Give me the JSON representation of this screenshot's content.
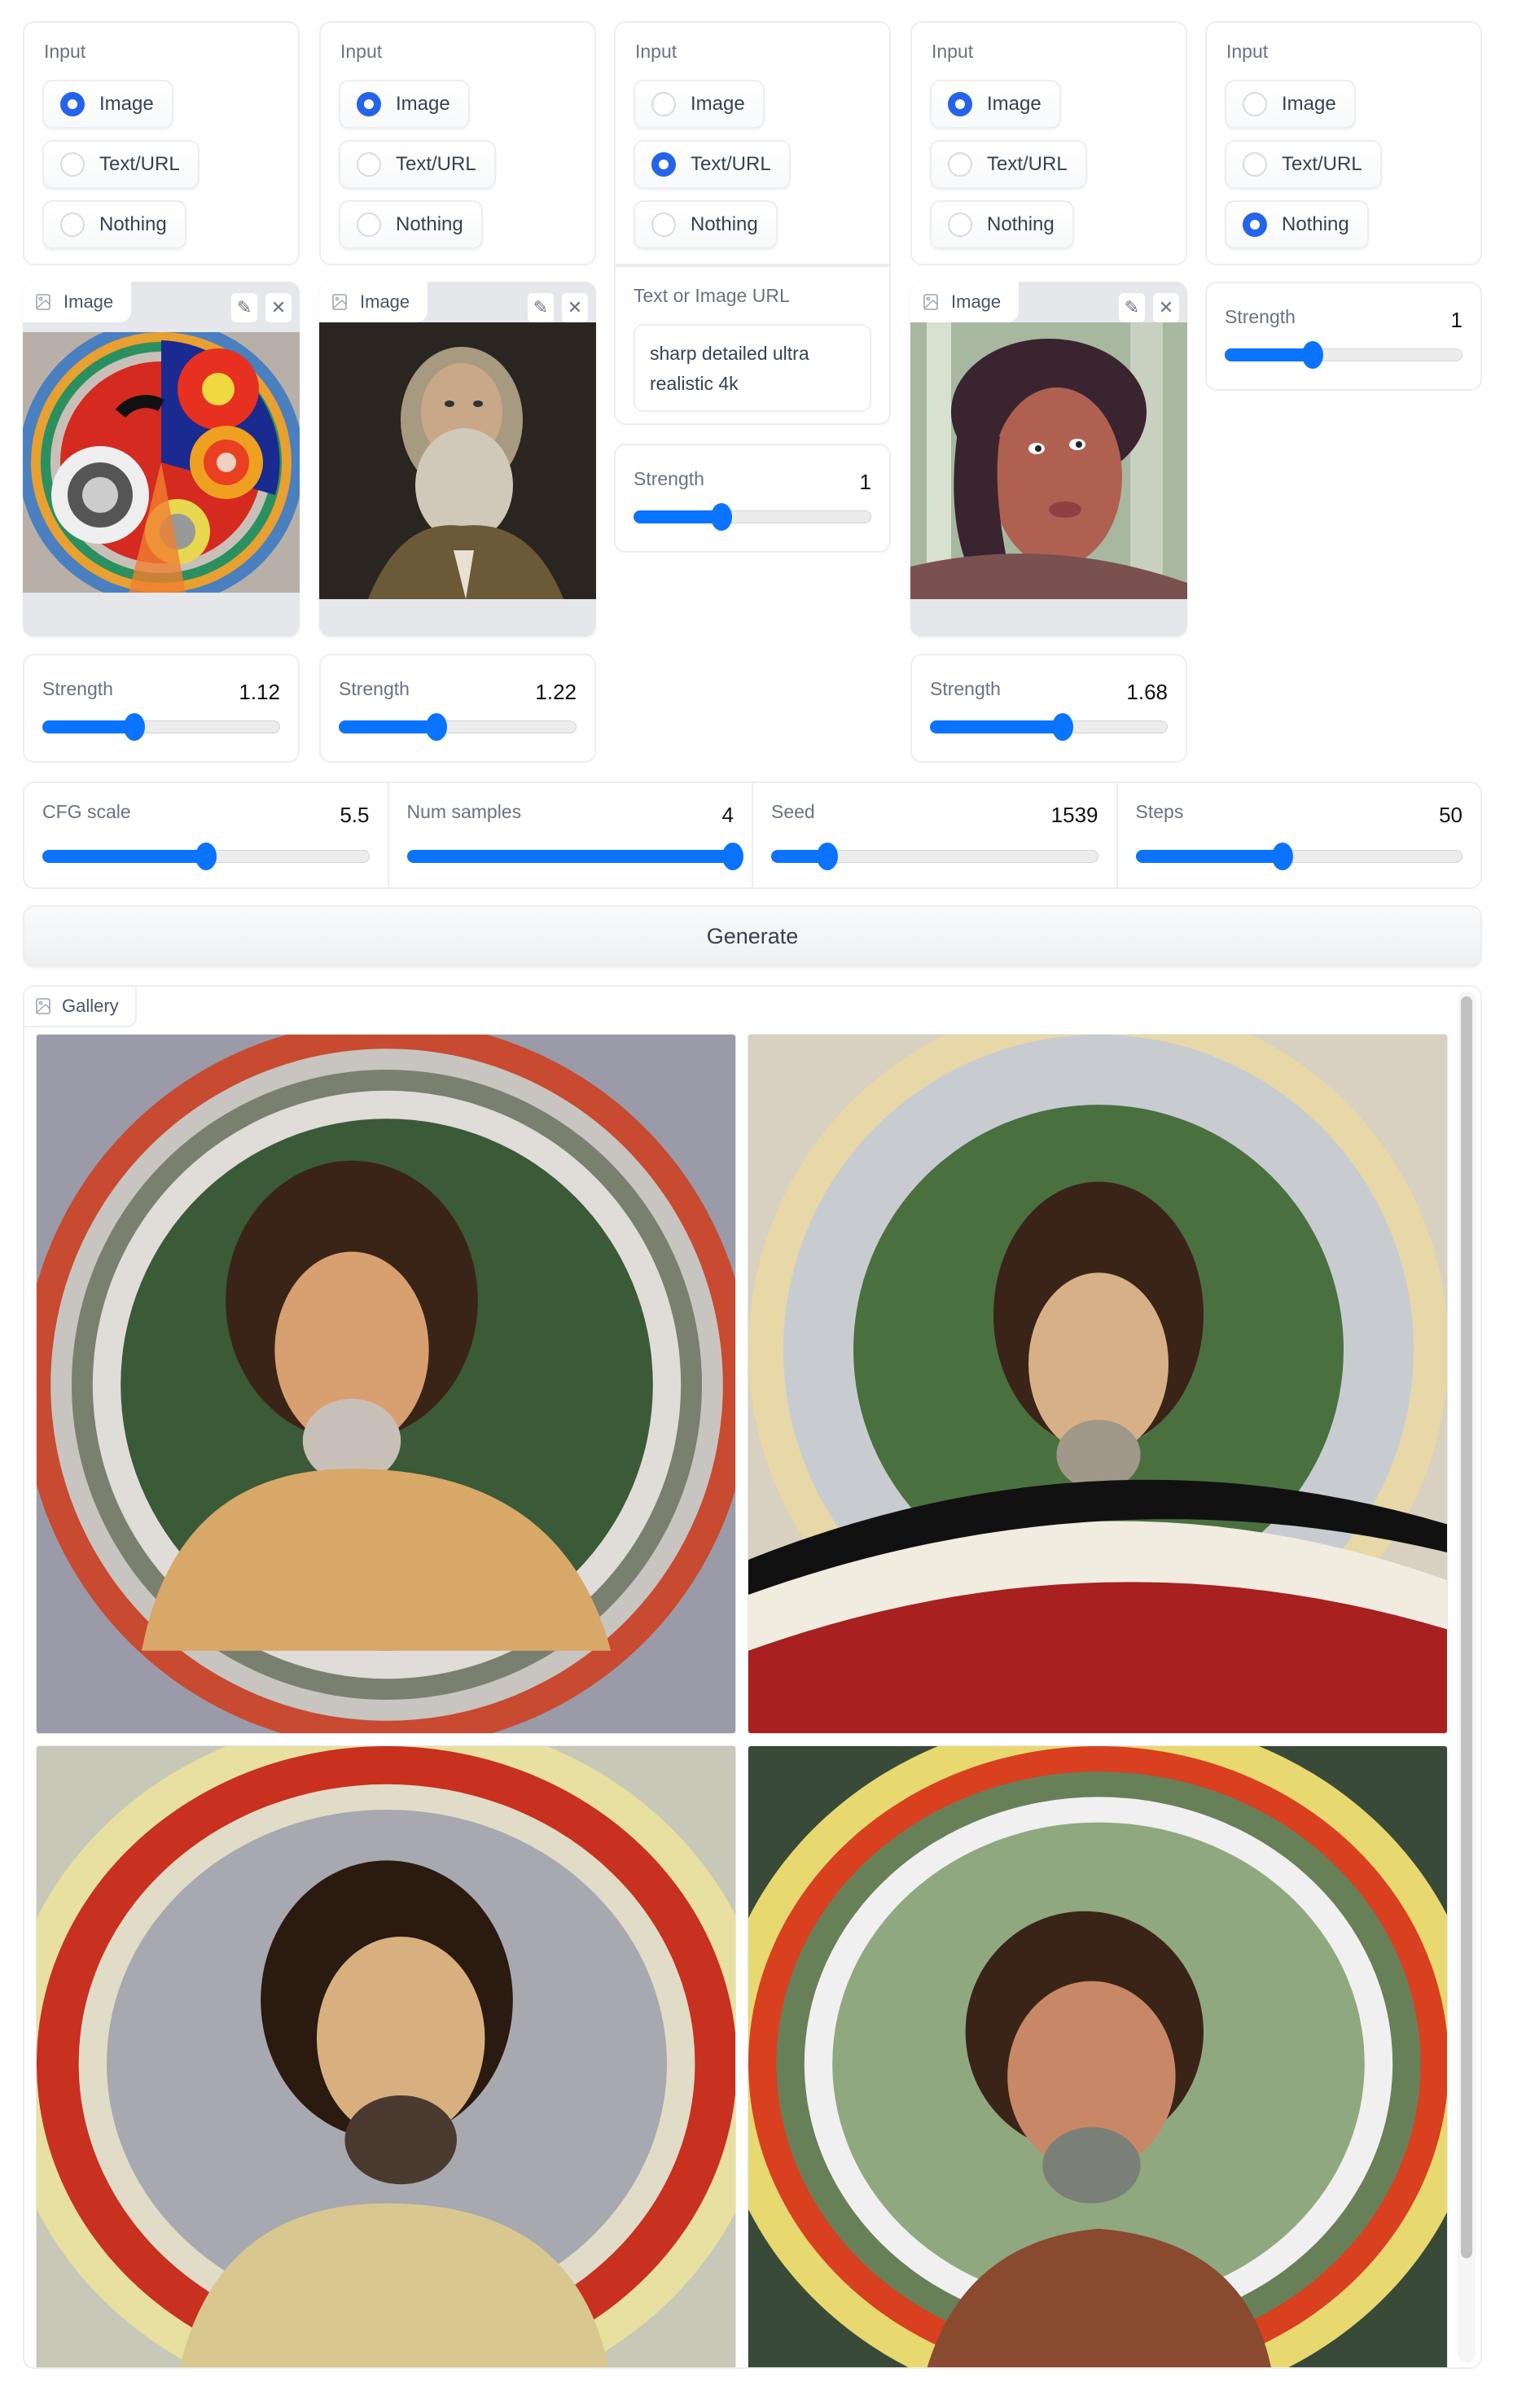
{
  "input_columns": [
    {
      "label": "Input",
      "options": [
        "Image",
        "Text/URL",
        "Nothing"
      ],
      "selected": "Image"
    },
    {
      "label": "Input",
      "options": [
        "Image",
        "Text/URL",
        "Nothing"
      ],
      "selected": "Image"
    },
    {
      "label": "Input",
      "options": [
        "Image",
        "Text/URL",
        "Nothing"
      ],
      "selected": "Text/URL"
    },
    {
      "label": "Input",
      "options": [
        "Image",
        "Text/URL",
        "Nothing"
      ],
      "selected": "Image"
    },
    {
      "label": "Input",
      "options": [
        "Image",
        "Text/URL",
        "Nothing"
      ],
      "selected": "Nothing"
    }
  ],
  "image_inputs": [
    {
      "tab_label": "Image",
      "icon": "image-icon",
      "edit_icon": "pencil-icon",
      "clear_icon": "close-icon",
      "content": "abstract circular painting with colorful concentric rings"
    },
    {
      "tab_label": "Image",
      "icon": "image-icon",
      "edit_icon": "pencil-icon",
      "clear_icon": "close-icon",
      "content": "portrait painting of an old bearded man"
    },
    {
      "tab_label": "Image",
      "icon": "image-icon",
      "edit_icon": "pencil-icon",
      "clear_icon": "close-icon",
      "content": "photo of a man with long dark hair and headband in a forest"
    }
  ],
  "text_input": {
    "label": "Text or Image URL",
    "value": "sharp detailed ultra realistic 4k"
  },
  "strengths": [
    {
      "label": "Strength",
      "value": "1.12",
      "fraction": 0.385
    },
    {
      "label": "Strength",
      "value": "1.22",
      "fraction": 0.41
    },
    {
      "label": "Strength",
      "value": "1",
      "fraction": 0.37
    },
    {
      "label": "Strength",
      "value": "1.68",
      "fraction": 0.56
    },
    {
      "label": "Strength",
      "value": "1",
      "fraction": 0.37
    }
  ],
  "settings": [
    {
      "label": "CFG scale",
      "value": "5.5",
      "fraction": 0.5
    },
    {
      "label": "Num samples",
      "value": "4",
      "fraction": 1.0
    },
    {
      "label": "Seed",
      "value": "1539",
      "fraction": 0.17
    },
    {
      "label": "Steps",
      "value": "50",
      "fraction": 0.45
    }
  ],
  "generate_button": {
    "label": "Generate"
  },
  "gallery": {
    "label": "Gallery",
    "icon": "image-icon",
    "images": [
      {
        "content": "generated portrait of long-haired bearded man in circular abstract rings"
      },
      {
        "content": "generated portrait of man with green circular background and swirling bands"
      },
      {
        "content": "generated portrait of wide-eyed bearded man framed by colorful rings"
      },
      {
        "content": "generated portrait of man in forest framed by concentric colored arcs"
      }
    ]
  },
  "colors": {
    "accent": "#2563eb",
    "slider": "#0a73ff",
    "border": "#eceef1",
    "muted_text": "#6b7280"
  }
}
